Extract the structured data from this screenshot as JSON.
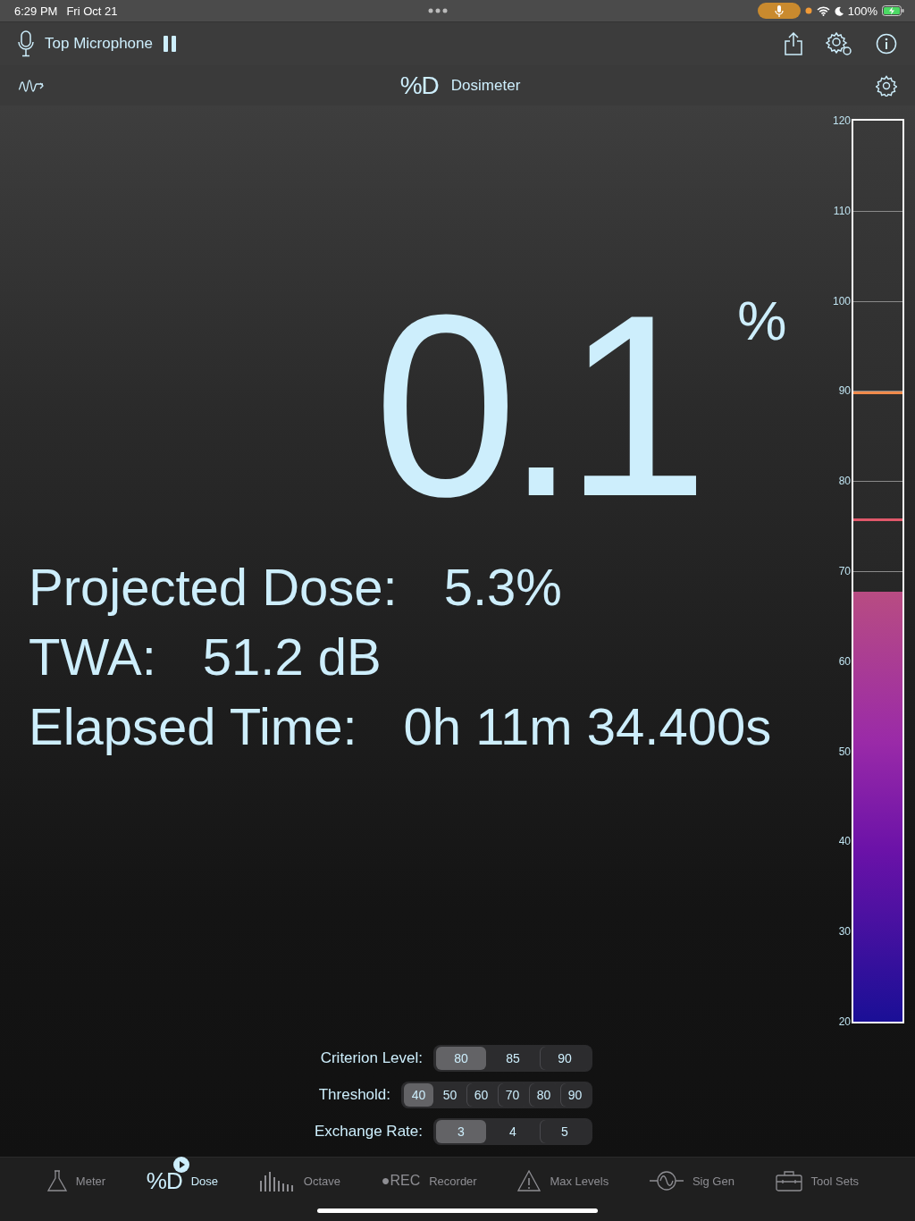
{
  "status_bar": {
    "time": "6:29 PM",
    "date": "Fri Oct 21",
    "battery": "100%"
  },
  "toolbar": {
    "input": "Top Microphone"
  },
  "header": {
    "logo": "%D",
    "title": "Dosimeter"
  },
  "dose": {
    "value": "0.1",
    "unit": "%"
  },
  "stats": [
    {
      "label": "Projected Dose:",
      "value": "5.3%"
    },
    {
      "label": "TWA:",
      "value": "51.2 dB"
    },
    {
      "label": "Elapsed Time:",
      "value": "0h 11m 34.400s"
    }
  ],
  "meter": {
    "ticks": [
      "120",
      "110",
      "100",
      "90",
      "80",
      "70",
      "60",
      "50",
      "40",
      "30",
      "20"
    ],
    "level": 0.477,
    "markers": [
      {
        "level": 0.696,
        "color": "#f08a4b"
      },
      {
        "level": 0.556,
        "color": "#e0586a"
      }
    ]
  },
  "settings": [
    {
      "label": "Criterion Level:",
      "options": [
        {
          "label": "80",
          "selected": true
        },
        {
          "label": "85",
          "selected": false
        },
        {
          "label": "90",
          "selected": false
        }
      ]
    },
    {
      "label": "Threshold:",
      "options": [
        {
          "label": "40",
          "selected": true
        },
        {
          "label": "50",
          "selected": false
        },
        {
          "label": "60",
          "selected": false
        },
        {
          "label": "70",
          "selected": false
        },
        {
          "label": "80",
          "selected": false
        },
        {
          "label": "90",
          "selected": false
        }
      ]
    },
    {
      "label": "Exchange Rate:",
      "options": [
        {
          "label": "3",
          "selected": true
        },
        {
          "label": "4",
          "selected": false
        },
        {
          "label": "5",
          "selected": false
        }
      ]
    }
  ],
  "tabs": [
    {
      "kind": "meter",
      "label": "Meter",
      "selected": false
    },
    {
      "kind": "dose",
      "glyph": "%D",
      "label": "Dose",
      "selected": true
    },
    {
      "kind": "octave",
      "label": "Octave",
      "selected": false
    },
    {
      "kind": "recorder",
      "glyph": "●REC",
      "label": "Recorder",
      "selected": false
    },
    {
      "kind": "max",
      "label": "Max Levels",
      "selected": false
    },
    {
      "kind": "siggen",
      "label": "Sig Gen",
      "selected": false
    },
    {
      "kind": "tools",
      "label": "Tool Sets",
      "selected": false
    }
  ]
}
